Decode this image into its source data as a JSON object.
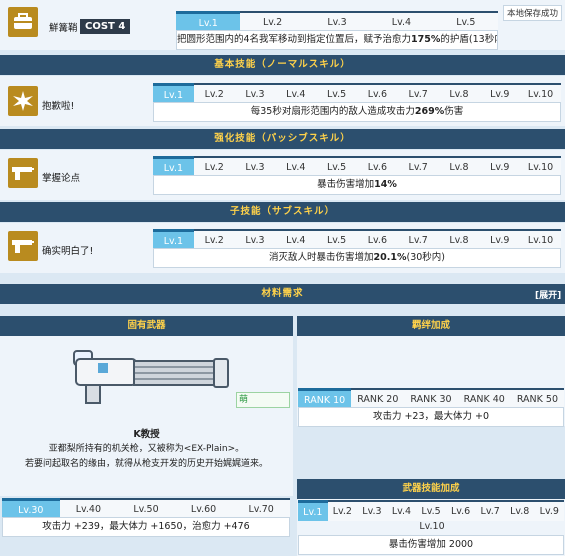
{
  "top": {
    "skill_name": "鮮篝鞘",
    "cost_label": "COST 4",
    "save_status": "本地保存成功",
    "tabs": [
      "Lv.1",
      "Lv.2",
      "Lv.3",
      "Lv.4",
      "Lv.5"
    ],
    "desc_pre": "把圆形范围内的4名我军移动到指定位置后，赋予治愈力",
    "desc_bold": "175%",
    "desc_post": "的护盾(13秒内)"
  },
  "basic": {
    "header": "基本技能（ノーマルスキル）",
    "skill_name": "抱歉啦!",
    "tabs": [
      "Lv.1",
      "Lv.2",
      "Lv.3",
      "Lv.4",
      "Lv.5",
      "Lv.6",
      "Lv.7",
      "Lv.8",
      "Lv.9",
      "Lv.10"
    ],
    "desc_pre": "每35秒对扇形范围内的敌人造成攻击力",
    "desc_bold": "269%",
    "desc_post": "伤害"
  },
  "passive": {
    "header": "强化技能（パッシブスキル）",
    "skill_name": "掌握论点",
    "tabs": [
      "Lv.1",
      "Lv.2",
      "Lv.3",
      "Lv.4",
      "Lv.5",
      "Lv.6",
      "Lv.7",
      "Lv.8",
      "Lv.9",
      "Lv.10"
    ],
    "desc_pre": "暴击伤害增加",
    "desc_bold": "14%",
    "desc_post": ""
  },
  "sub": {
    "header": "子技能（サブスキル）",
    "skill_name": "确实明白了!",
    "tabs": [
      "Lv.1",
      "Lv.2",
      "Lv.3",
      "Lv.4",
      "Lv.5",
      "Lv.6",
      "Lv.7",
      "Lv.8",
      "Lv.9",
      "Lv.10"
    ],
    "desc_pre": "消灭敌人时暴击伤害增加",
    "desc_bold": "20.1%",
    "desc_post": "(30秒内)"
  },
  "materials": {
    "header": "材料需求",
    "expand": "[展开]"
  },
  "weapon": {
    "header": "固有武器",
    "name": "K教授",
    "desc1": "亚都梨所持有的机关枪，又被称为<EX-Plain>。",
    "desc2": "若要问起取名的缘由，就得从枪支开发的历史开始娓娓道来。",
    "watermark": "萌",
    "tabs": [
      "Lv.30",
      "Lv.40",
      "Lv.50",
      "Lv.60",
      "Lv.70"
    ],
    "stats": "攻击力 +239，最大体力 +1650，治愈力 +476"
  },
  "bond": {
    "header": "羁绊加成",
    "tabs": [
      "RANK 10",
      "RANK 20",
      "RANK 30",
      "RANK 40",
      "RANK 50"
    ],
    "stats": "攻击力 +23，最大体力 +0"
  },
  "weapon_skill": {
    "header": "武器技能加成",
    "tabs": [
      "Lv.1",
      "Lv.2",
      "Lv.3",
      "Lv.4",
      "Lv.5",
      "Lv.6",
      "Lv.7",
      "Lv.8",
      "Lv.9"
    ],
    "tab_extra": "Lv.10",
    "stats": "暴击伤害增加 2000"
  },
  "colors": {
    "header_bg": "#2c4f6e",
    "header_text": "#ffd24a",
    "active_tab": "#6cc3e9",
    "icon_bg": "#b98b1f"
  }
}
